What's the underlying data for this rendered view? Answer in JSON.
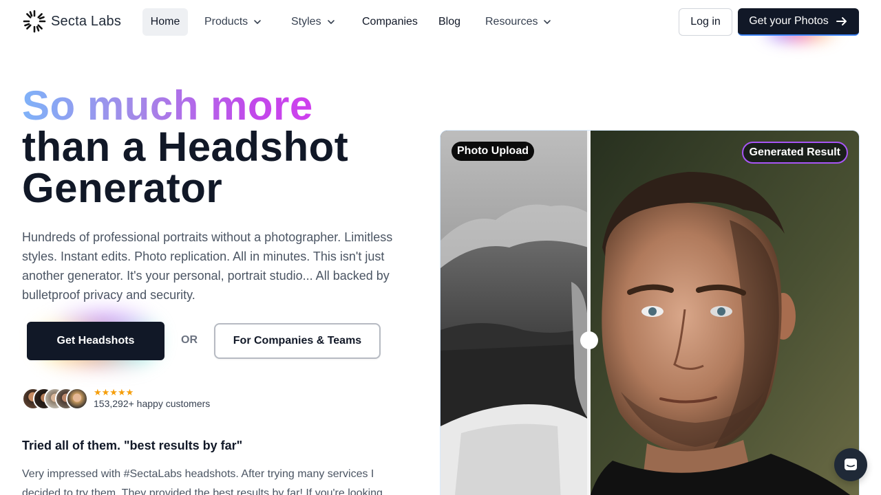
{
  "nav": {
    "logo_text": "Secta Labs",
    "items": [
      {
        "label": "Home"
      },
      {
        "label": "Products"
      },
      {
        "label": "Styles"
      },
      {
        "label": "Companies"
      },
      {
        "label": "Blog"
      },
      {
        "label": "Resources"
      }
    ],
    "login_label": "Log in",
    "get_photos_label": "Get your Photos"
  },
  "hero": {
    "headline_line1": "So much more",
    "headline_line2": "than a Headshot",
    "headline_line3": "Generator",
    "lead": "Hundreds of professional portraits without a photographer. Limitless styles. Instant edits. Photo replication. All in minutes. This isn't just another generator. It's your personal, portrait studio... All backed by bulletproof privacy and security.",
    "cta_primary": "Get Headshots",
    "or_text": "OR",
    "cta_secondary": "For Companies & Teams"
  },
  "social_proof": {
    "stars": "★★★★★",
    "customers": "153,292+ happy customers",
    "rating": 5
  },
  "testimonial": {
    "title": "Tried all of them. \"best results by far\"",
    "body": "Very impressed with #SectaLabs headshots. After trying many services I decided to try them. They provided the best results by far! If you're looking"
  },
  "comparison": {
    "left_label": "Photo Upload",
    "right_label": "Generated Result",
    "slider_position": 0.36
  },
  "colors": {
    "primary_dark": "#111827",
    "accent_purple": "#a855f7",
    "gradient_start": "#7fb2f8",
    "gradient_end": "#d63af0",
    "star": "#f59e0b"
  },
  "icons": [
    "logo-mark-icon",
    "chevron-down-icon",
    "arrow-right-icon",
    "chat-icon"
  ]
}
